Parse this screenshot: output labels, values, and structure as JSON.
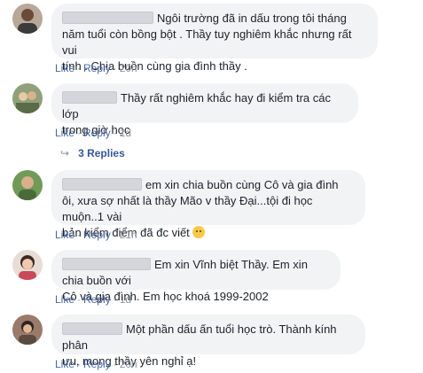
{
  "comments": [
    {
      "lines": [
        "Ngôi trường đã in dấu trong tôi tháng",
        "năm tuổi còn bồng bột . Thầy tuy nghiêm khắc nhưng rất vui",
        "tính . Chia buồn cùng gia đình thầy ."
      ],
      "like": "Like",
      "reply": "Reply",
      "time": "20h"
    },
    {
      "lines": [
        "Thầy rất nghiêm khắc hay đi kiểm tra các lớp",
        "trong giờ học"
      ],
      "like": "Like",
      "reply": "Reply",
      "time": "1d",
      "replies_label": "3 Replies"
    },
    {
      "lines": [
        "em xin chia buồn cùng Cô và gia đình",
        "ôi, xưa sợ nhất là thầy Mão v thầy Đại...tội đi học muộn..1 vài",
        "bản kiểm điểm đã đc viết"
      ],
      "emoji": "sad-face-emoji",
      "like": "Like",
      "reply": "Reply",
      "time": "21h"
    },
    {
      "lines": [
        "Em xin Vĩnh biệt Thầy. Em xin chia buồn với",
        "Cô và gia đình. Em học khoá 1999-2002"
      ],
      "like": "Like",
      "reply": "Reply",
      "time": "1d"
    },
    {
      "lines": [
        "Một phần dấu ấn tuổi học trò. Thành kính phân",
        "ưu, mong thầy yên nghỉ ạ!"
      ],
      "like": "Like",
      "reply": "Reply",
      "time": "20h"
    }
  ],
  "colors": {
    "bubble": "#f2f3f5",
    "link": "#4b67a1",
    "meta": "#8d949e"
  }
}
